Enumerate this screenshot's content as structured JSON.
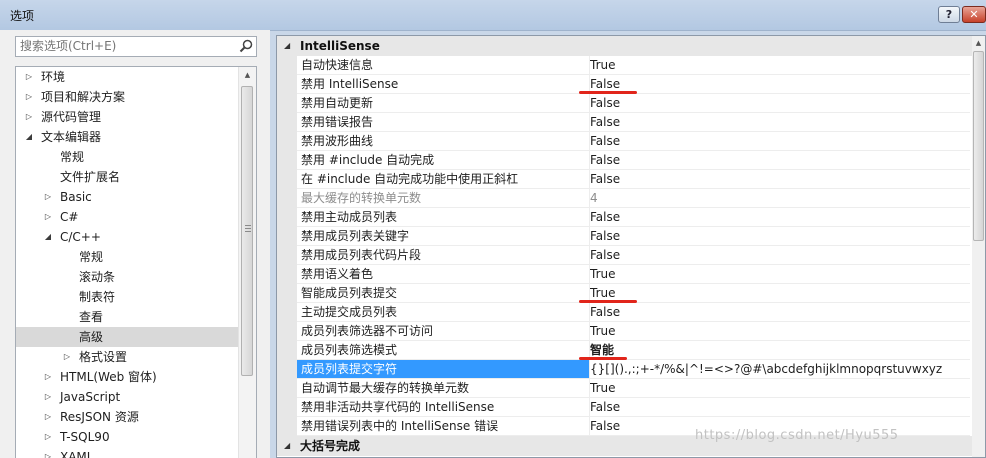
{
  "window": {
    "title": "选项",
    "help_label": "?",
    "close_label": "✕"
  },
  "search": {
    "placeholder": "搜索选项(Ctrl+E)",
    "icon": "search-icon"
  },
  "tree": [
    {
      "label": "环境",
      "level": 0,
      "arrow": "collapsed"
    },
    {
      "label": "项目和解决方案",
      "level": 0,
      "arrow": "collapsed"
    },
    {
      "label": "源代码管理",
      "level": 0,
      "arrow": "collapsed"
    },
    {
      "label": "文本编辑器",
      "level": 0,
      "arrow": "expanded"
    },
    {
      "label": "常规",
      "level": 1,
      "arrow": "none"
    },
    {
      "label": "文件扩展名",
      "level": 1,
      "arrow": "none"
    },
    {
      "label": "Basic",
      "level": 1,
      "arrow": "collapsed"
    },
    {
      "label": "C#",
      "level": 1,
      "arrow": "collapsed"
    },
    {
      "label": "C/C++",
      "level": 1,
      "arrow": "expanded"
    },
    {
      "label": "常规",
      "level": 2,
      "arrow": "none"
    },
    {
      "label": "滚动条",
      "level": 2,
      "arrow": "none"
    },
    {
      "label": "制表符",
      "level": 2,
      "arrow": "none"
    },
    {
      "label": "查看",
      "level": 2,
      "arrow": "none"
    },
    {
      "label": "高级",
      "level": 2,
      "arrow": "none",
      "selected": true
    },
    {
      "label": "格式设置",
      "level": 2,
      "arrow": "collapsed"
    },
    {
      "label": "HTML(Web 窗体)",
      "level": 1,
      "arrow": "collapsed"
    },
    {
      "label": "JavaScript",
      "level": 1,
      "arrow": "collapsed"
    },
    {
      "label": "ResJSON 资源",
      "level": 1,
      "arrow": "collapsed"
    },
    {
      "label": "T-SQL90",
      "level": 1,
      "arrow": "collapsed"
    },
    {
      "label": "XAML",
      "level": 1,
      "arrow": "collapsed"
    }
  ],
  "properties": {
    "category": "IntelliSense",
    "rows": [
      {
        "name": "自动快速信息",
        "value": "True"
      },
      {
        "name": "禁用 IntelliSense",
        "value": "False",
        "underline": true
      },
      {
        "name": "禁用自动更新",
        "value": "False"
      },
      {
        "name": "禁用错误报告",
        "value": "False"
      },
      {
        "name": "禁用波形曲线",
        "value": "False"
      },
      {
        "name": "禁用 #include 自动完成",
        "value": "False"
      },
      {
        "name": "在 #include 自动完成功能中使用正斜杠",
        "value": "False"
      },
      {
        "name": "最大缓存的转换单元数",
        "value": "4",
        "disabled": true
      },
      {
        "name": "禁用主动成员列表",
        "value": "False"
      },
      {
        "name": "禁用成员列表关键字",
        "value": "False"
      },
      {
        "name": "禁用成员列表代码片段",
        "value": "False"
      },
      {
        "name": "禁用语义着色",
        "value": "True"
      },
      {
        "name": "智能成员列表提交",
        "value": "True",
        "underline": true
      },
      {
        "name": "主动提交成员列表",
        "value": "False"
      },
      {
        "name": "成员列表筛选器不可访问",
        "value": "True"
      },
      {
        "name": "成员列表筛选模式",
        "value": "智能",
        "bold": true,
        "underline": true
      },
      {
        "name": "成员列表提交字符",
        "value": "{}[]().,:;+-*/%&|^!=<>?@#\\abcdefghijklmnopqrstuvwxyz",
        "selected": true
      },
      {
        "name": "自动调节最大缓存的转换单元数",
        "value": "True"
      },
      {
        "name": "禁用非活动共享代码的 IntelliSense",
        "value": "False"
      },
      {
        "name": "禁用错误列表中的 IntelliSense 错误",
        "value": "False"
      }
    ],
    "next_category": "大括号完成"
  },
  "watermark": "https://blog.csdn.net/Hyu555",
  "colors": {
    "selection": "#3399ff",
    "annotation": "#e1251b"
  }
}
